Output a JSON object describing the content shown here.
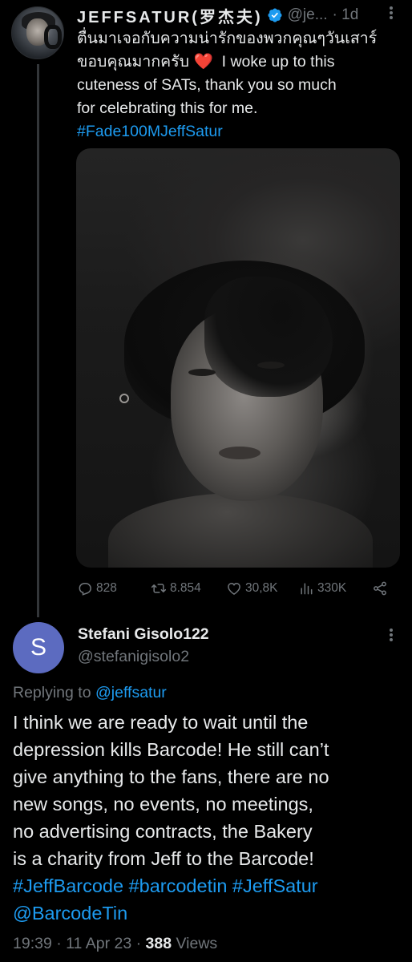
{
  "parent_tweet": {
    "author_name": "JEFFSATUR(罗杰夫)",
    "handle": "@je...",
    "separator": "·",
    "time": "1d",
    "text_lines": [
      "ตื่นมาเจอกับความน่ารักของพวกคุณๆวันเสาร์",
      "ขอบคุณมากครับ",
      "I woke up to this",
      "cuteness of SATs, thank you so much",
      "for celebrating this for me."
    ],
    "hashtag": "#Fade100MJeffSatur",
    "media_alt": "Black and white portrait photo",
    "stats": {
      "replies": "828",
      "retweets": "8.854",
      "likes": "30,8K",
      "views": "330K"
    }
  },
  "reply_tweet": {
    "avatar_letter": "S",
    "author_name": "Stefani Gisolo122",
    "handle": "@stefanigisolo2",
    "replying_to_label": "Replying to",
    "replying_to_mention": "@jeffsatur",
    "text_lines": [
      "I think we are ready to wait until the",
      "depression kills Barcode! He still can’t",
      "give anything to the fans, there are no",
      "new songs, no events, no meetings,",
      "no advertising contracts, the Bakery",
      "is a charity from Jeff to the Barcode!"
    ],
    "hashtags_line": "#JeffBarcode #barcodetin #JeffSatur",
    "mention_line": "@BarcodeTin",
    "time": "19:39",
    "date": "11 Apr 23",
    "views_count": "388",
    "views_label": "Views"
  },
  "colors": {
    "background": "#000000",
    "text": "#e7e9ea",
    "muted": "#71767b",
    "link": "#1d9bf0",
    "verified": "#1d9bf0",
    "heart": "#f4212e",
    "avatar_bg": "#5c6bc0"
  }
}
